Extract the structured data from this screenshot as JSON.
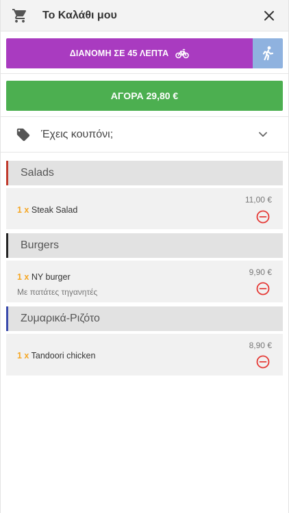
{
  "header": {
    "title": "Το Καλάθι μου"
  },
  "delivery": {
    "label": "ΔΙΑΝΟΜΗ ΣΕ 45 ΛΕΠΤΑ"
  },
  "buy": {
    "label": "ΑΓΟΡΑ 29,80 €"
  },
  "coupon": {
    "label": "Έχεις κουπόνι;"
  },
  "colors": {
    "delivery": "#a93bc0",
    "pickup": "#8fb2df",
    "buy": "#4caf50",
    "quantity": "#f5a623",
    "remove": "#e53935"
  },
  "categories": [
    {
      "name": "Salads",
      "accent": "#c0392b",
      "items": [
        {
          "qty": "1 x",
          "name": "Steak Salad",
          "price": "11,00 €",
          "note": ""
        }
      ]
    },
    {
      "name": "Burgers",
      "accent": "#222222",
      "items": [
        {
          "qty": "1 x",
          "name": "NY burger",
          "price": "9,90 €",
          "note": "Με πατάτες τηγανητές"
        }
      ]
    },
    {
      "name": "Ζυμαρικά-Ριζότο",
      "accent": "#3949ab",
      "items": [
        {
          "qty": "1 x",
          "name": "Tandoori chicken",
          "price": "8,90 €",
          "note": ""
        }
      ]
    }
  ]
}
